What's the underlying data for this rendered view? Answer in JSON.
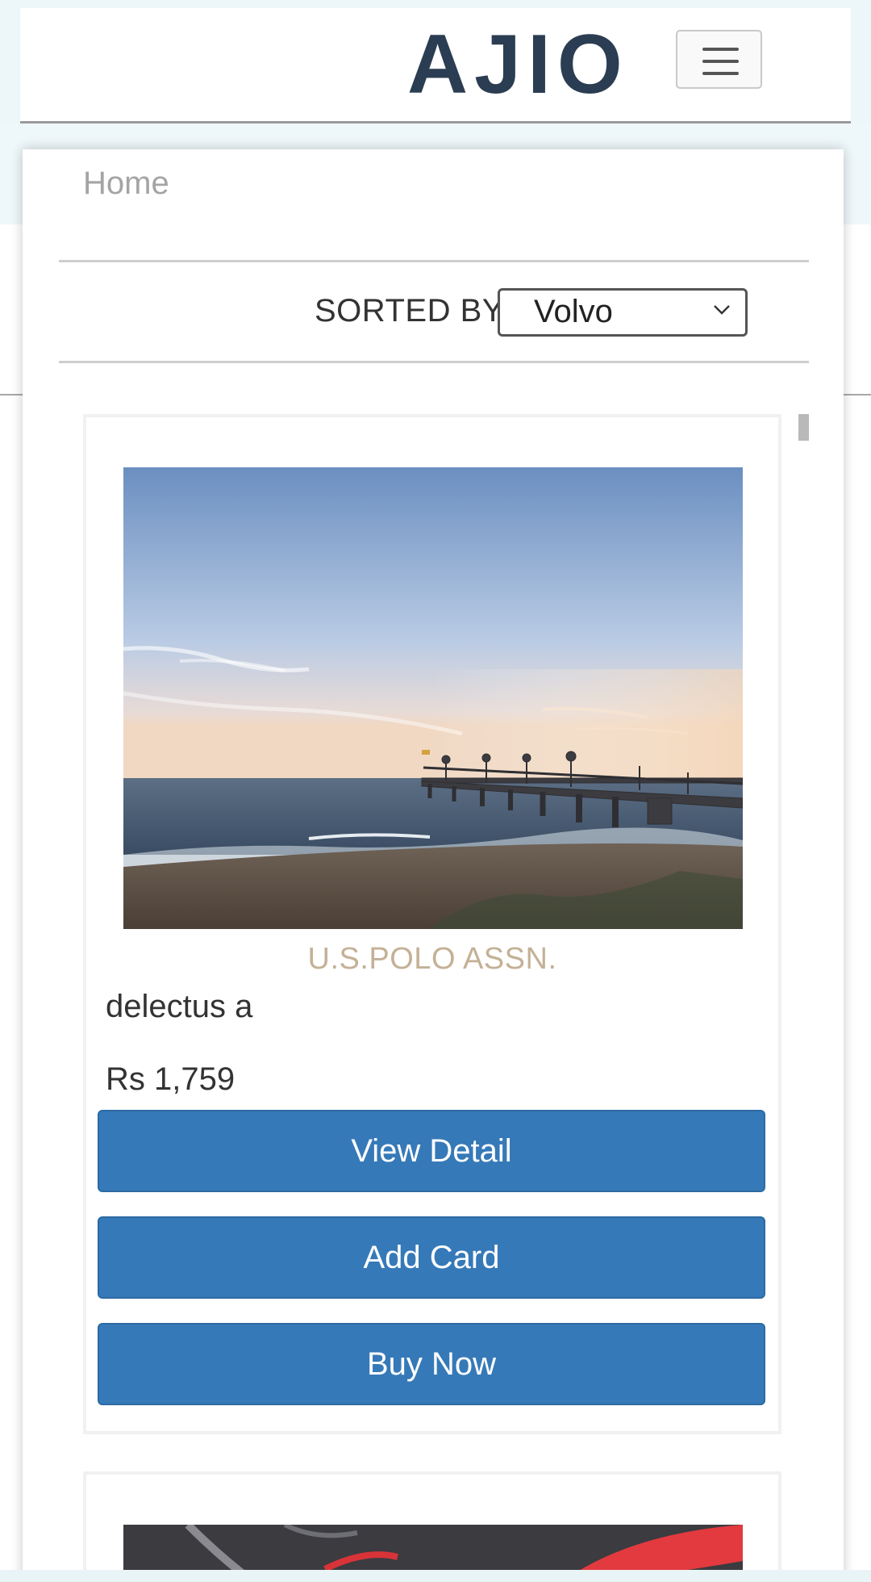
{
  "header": {
    "brand": "AJIO",
    "menu_icon": "hamburger-menu-icon"
  },
  "breadcrumb": {
    "home": "Home"
  },
  "sort": {
    "label": "SORTED BY",
    "selected": "Volvo",
    "icon": "chevron-down-icon"
  },
  "products": [
    {
      "brand": "U.S.POLO ASSN.",
      "name": "delectus a",
      "price": "Rs 1,759",
      "buttons": {
        "view": "View Detail",
        "add": "Add Card",
        "buy": "Buy Now"
      }
    }
  ],
  "colors": {
    "brand_text": "#2b3d52",
    "button": "#3679b8",
    "brand_name": "#c4b196"
  }
}
